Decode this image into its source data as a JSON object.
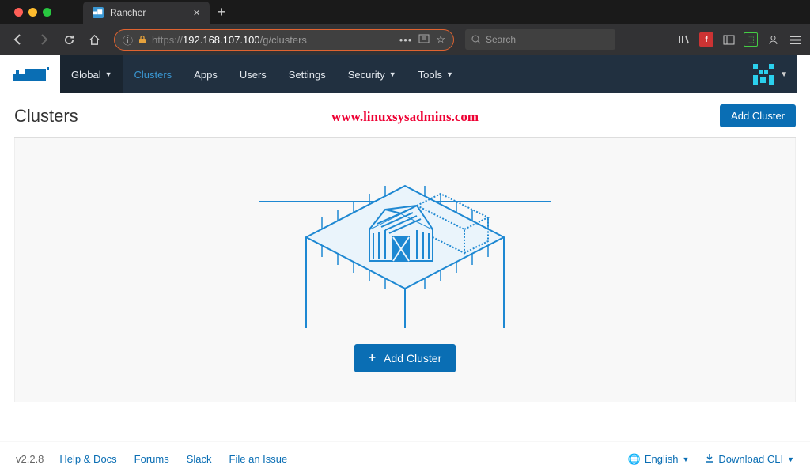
{
  "browser": {
    "tab_title": "Rancher",
    "url": {
      "protocol": "https://",
      "host": "192.168.107.100",
      "path": "/g/clusters"
    },
    "search_placeholder": "Search"
  },
  "navbar": {
    "global": "Global",
    "items": [
      "Clusters",
      "Apps",
      "Users",
      "Settings",
      "Security",
      "Tools"
    ]
  },
  "page": {
    "title": "Clusters",
    "watermark": "www.linuxsysadmins.com",
    "add_button": "Add Cluster",
    "empty_add_button": "Add Cluster"
  },
  "footer": {
    "version": "v2.2.8",
    "links": [
      "Help & Docs",
      "Forums",
      "Slack",
      "File an Issue"
    ],
    "language": "English",
    "download": "Download CLI"
  }
}
